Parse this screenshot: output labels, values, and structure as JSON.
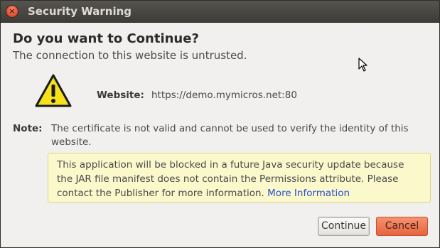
{
  "window": {
    "title": "Security Warning",
    "close_icon": "close-icon"
  },
  "dialog": {
    "heading": "Do you want to Continue?",
    "subheading": "The connection to this website is untrusted.",
    "icon": "warning-triangle-icon",
    "website_label": "Website:",
    "website_value": "https://demo.mymicros.net:80",
    "note_label": "Note:",
    "note_text": "The certificate is not valid and cannot be used to verify the identity of this website.",
    "info_text": "This application will be blocked in a future Java security update because the JAR file manifest does not contain the Permissions attribute. Please contact the Publisher for more information.",
    "info_link": "More Information"
  },
  "buttons": {
    "continue_label": "Continue",
    "cancel_label": "Cancel"
  },
  "colors": {
    "cancel_accent": "#e6643f",
    "info_bg": "#fbf8cc",
    "link": "#2a51c9",
    "warning_yellow": "#f5e21b"
  }
}
